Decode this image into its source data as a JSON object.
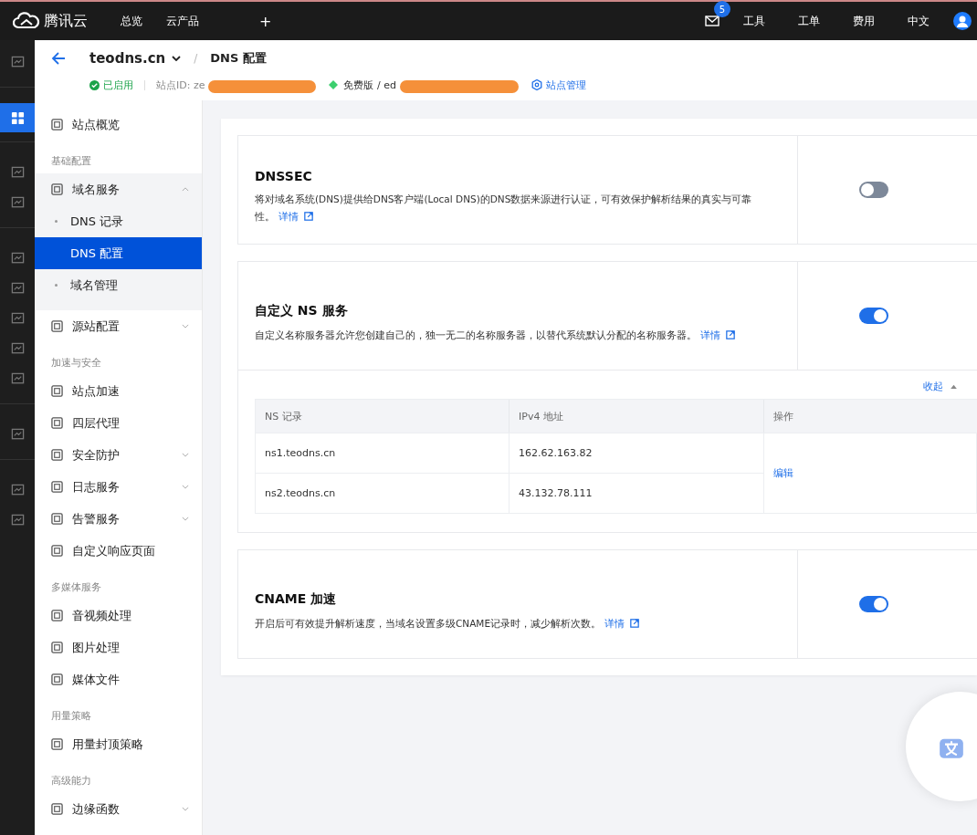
{
  "topbar": {
    "brand": "腾讯云",
    "nav": [
      "总览",
      "云产品",
      "+"
    ],
    "mail_badge": "5",
    "links": [
      "工具",
      "工单",
      "费用",
      "中文"
    ]
  },
  "header": {
    "site": "teodns.cn",
    "separator": "/",
    "page": "DNS 配置",
    "status": "已启用",
    "site_id_label": "站点ID: ze",
    "plan": "免费版 / ed",
    "manage": "站点管理"
  },
  "rail": [
    {
      "selected": false
    },
    {
      "selected": true
    },
    {
      "selected": false
    },
    {
      "selected": false
    },
    {
      "selected": false
    },
    {
      "selected": false
    },
    {
      "selected": false
    },
    {
      "selected": false
    },
    {
      "selected": false
    },
    {
      "selected": false
    },
    {
      "selected": false
    },
    {
      "selected": false
    }
  ],
  "sidebar": [
    {
      "items": [
        {
          "label": "站点概览",
          "selected": false
        }
      ]
    },
    {
      "heading": "基础配置",
      "items": [
        {
          "label": "域名服务",
          "selected": false,
          "expanded": true,
          "children": [
            {
              "label": "DNS 记录",
              "selected": false
            },
            {
              "label": "DNS 配置",
              "selected": true
            },
            {
              "label": "域名管理",
              "selected": false
            }
          ]
        },
        {
          "label": "源站配置",
          "selected": false,
          "expanded": false
        }
      ]
    },
    {
      "heading": "加速与安全",
      "items": [
        {
          "label": "站点加速",
          "selected": false
        },
        {
          "label": "四层代理",
          "selected": false
        },
        {
          "label": "安全防护",
          "selected": false,
          "expanded": false
        },
        {
          "label": "日志服务",
          "selected": false,
          "expanded": false
        },
        {
          "label": "告警服务",
          "selected": false,
          "expanded": false
        },
        {
          "label": "自定义响应页面",
          "selected": false
        }
      ]
    },
    {
      "heading": "多媒体服务",
      "items": [
        {
          "label": "音视频处理",
          "selected": false
        },
        {
          "label": "图片处理",
          "selected": false
        },
        {
          "label": "媒体文件",
          "selected": false
        }
      ]
    },
    {
      "heading": "用量策略",
      "items": [
        {
          "label": "用量封顶策略",
          "selected": false
        }
      ]
    },
    {
      "heading": "高级能力",
      "items": [
        {
          "label": "边缘函数",
          "selected": false,
          "expanded": false
        }
      ]
    }
  ],
  "sections": [
    {
      "title": "DNSSEC",
      "description": "将对域名系统(DNS)提供给DNS客户端(Local DNS)的DNS数据来源进行认证，可有效保护解析结果的真实与可靠性。",
      "link": "详情",
      "on": false
    },
    {
      "title": "自定义 NS 服务",
      "description": "自定义名称服务器允许您创建自己的，独一无二的名称服务器，以替代系统默认分配的名称服务器。",
      "link": "详情",
      "on": true,
      "collapse": {
        "label": "收起",
        "expanded": true
      },
      "table": {
        "columns": [
          "NS 记录",
          "IPv4 地址",
          "操作"
        ],
        "rows": [
          [
            "ns1.teodns.cn",
            "162.62.163.82"
          ],
          [
            "ns2.teodns.cn",
            "43.132.78.111"
          ]
        ],
        "action": "编辑"
      }
    },
    {
      "title": "CNAME 加速",
      "description": "开启后可有效提升解析速度，当域名设置多级CNAME记录时，减少解析次数。",
      "link": "详情",
      "on": true
    }
  ]
}
